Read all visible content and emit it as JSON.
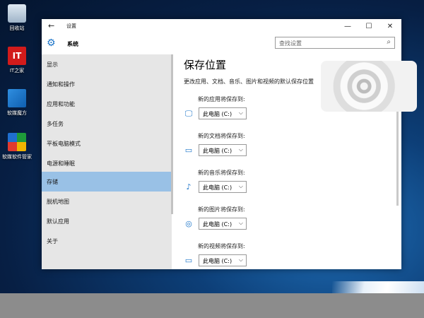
{
  "desktop": {
    "icons": [
      {
        "label": "回收站",
        "icon": "recycle-bin-icon"
      },
      {
        "label": "IT之家",
        "icon": "ithome-app-icon"
      },
      {
        "label": "软媒魔方",
        "icon": "ruanmei-mofang-icon"
      },
      {
        "label": "软媒软件管家",
        "icon": "ruanmei-software-manager-icon"
      }
    ]
  },
  "window": {
    "title": "设置",
    "controls": {
      "back": "←",
      "minimize": "—",
      "maximize": "☐",
      "close": "✕"
    }
  },
  "header": {
    "section": "系统",
    "search_placeholder": "查找设置"
  },
  "sidebar": {
    "items": [
      {
        "label": "显示"
      },
      {
        "label": "通知和操作"
      },
      {
        "label": "应用和功能"
      },
      {
        "label": "多任务"
      },
      {
        "label": "平板电脑模式"
      },
      {
        "label": "电源和睡眠"
      },
      {
        "label": "存储",
        "active": true
      },
      {
        "label": "脱机地图"
      },
      {
        "label": "默认应用"
      },
      {
        "label": "关于"
      }
    ]
  },
  "content": {
    "title": "保存位置",
    "description": "更改应用、文档、音乐、图片和视频的默认保存位置",
    "rows": [
      {
        "label": "新的应用将保存到:",
        "value": "此电脑 (C:)",
        "icon": "monitor-icon"
      },
      {
        "label": "新的文档将保存到:",
        "value": "此电脑 (C:)",
        "icon": "document-drive-icon"
      },
      {
        "label": "新的音乐将保存到:",
        "value": "此电脑 (C:)",
        "icon": "music-note-icon"
      },
      {
        "label": "新的图片将保存到:",
        "value": "此电脑 (C:)",
        "icon": "camera-icon"
      },
      {
        "label": "新的视频将保存到:",
        "value": "此电脑 (C:)",
        "icon": "video-camera-icon"
      }
    ]
  },
  "colors": {
    "accent": "#1a73c8",
    "selected_item": "#99c1e6",
    "sidebar_bg": "#e6e6e6"
  }
}
